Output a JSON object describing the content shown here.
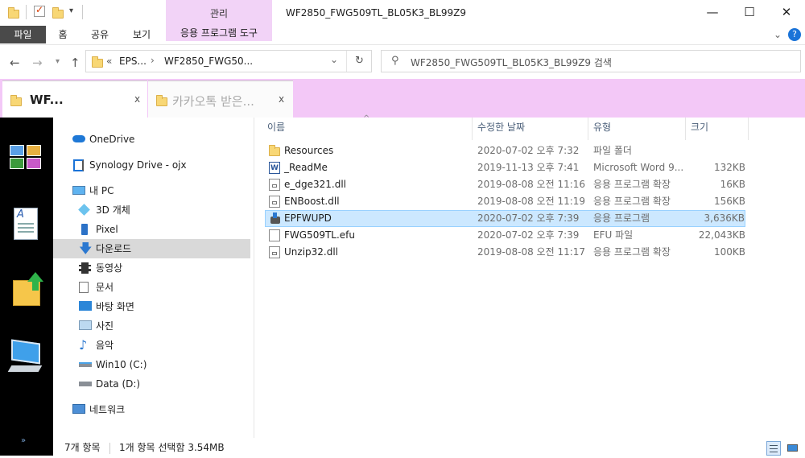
{
  "window": {
    "title": "WF2850_FWG509TL_BL05K3_BL99Z9",
    "context_tab_header": "관리",
    "minimize": "—",
    "maximize": "☐",
    "close": "✕"
  },
  "ribbon": {
    "tabs": [
      "파일",
      "홈",
      "공유",
      "보기"
    ],
    "context_tab": "응용 프로그램 도구",
    "expand_glyph": "⌄",
    "help_glyph": "?"
  },
  "address": {
    "overflow": "«",
    "crumbs": [
      "EPS...",
      "WF2850_FWG50..."
    ],
    "search_placeholder": "WF2850_FWG509TL_BL05K3_BL99Z9 검색"
  },
  "browser_tabs": [
    {
      "label": "WF...",
      "close": "x"
    },
    {
      "label": "카카오톡 받은...",
      "close": "x"
    }
  ],
  "dock": {
    "expand": "»"
  },
  "nav": {
    "items": [
      {
        "label": "OneDrive",
        "icon": "cloud-icon"
      },
      {
        "label": "Synology Drive - ojx",
        "icon": "synology-icon"
      },
      {
        "label": "내 PC",
        "icon": "pc-icon"
      },
      {
        "label": "3D 개체",
        "icon": "cube-icon"
      },
      {
        "label": "Pixel",
        "icon": "phone-icon"
      },
      {
        "label": "다운로드",
        "icon": "download-icon"
      },
      {
        "label": "동영상",
        "icon": "video-icon"
      },
      {
        "label": "문서",
        "icon": "document-icon"
      },
      {
        "label": "바탕 화면",
        "icon": "desktop-icon"
      },
      {
        "label": "사진",
        "icon": "pictures-icon"
      },
      {
        "label": "음악",
        "icon": "music-icon"
      },
      {
        "label": "Win10 (C:)",
        "icon": "drive-c-icon"
      },
      {
        "label": "Data (D:)",
        "icon": "drive-d-icon"
      },
      {
        "label": "네트워크",
        "icon": "network-icon"
      }
    ]
  },
  "files": {
    "columns": [
      "이름",
      "수정한 날짜",
      "유형",
      "크기"
    ],
    "rows": [
      {
        "name": "Resources",
        "date": "2020-07-02 오후 7:32",
        "type": "파일 폴더",
        "size": "",
        "icon": "folder-icon"
      },
      {
        "name": "_ReadMe",
        "date": "2019-11-13 오후 7:41",
        "type": "Microsoft Word 9...",
        "size": "132KB",
        "icon": "word-doc-icon"
      },
      {
        "name": "e_dge321.dll",
        "date": "2019-08-08 오전 11:16",
        "type": "응용 프로그램 확장",
        "size": "16KB",
        "icon": "dll-icon"
      },
      {
        "name": "ENBoost.dll",
        "date": "2019-08-08 오전 11:19",
        "type": "응용 프로그램 확장",
        "size": "156KB",
        "icon": "dll-icon"
      },
      {
        "name": "EPFWUPD",
        "date": "2020-07-02 오후 7:39",
        "type": "응용 프로그램",
        "size": "3,636KB",
        "icon": "installer-icon",
        "selected": true
      },
      {
        "name": "FWG509TL.efu",
        "date": "2020-07-02 오후 7:39",
        "type": "EFU 파일",
        "size": "22,043KB",
        "icon": "file-icon"
      },
      {
        "name": "Unzip32.dll",
        "date": "2019-08-08 오전 11:17",
        "type": "응용 프로그램 확장",
        "size": "100KB",
        "icon": "dll-icon"
      }
    ]
  },
  "status": {
    "count": "7개 항목",
    "selection": "1개 항목 선택함 3.54MB"
  }
}
